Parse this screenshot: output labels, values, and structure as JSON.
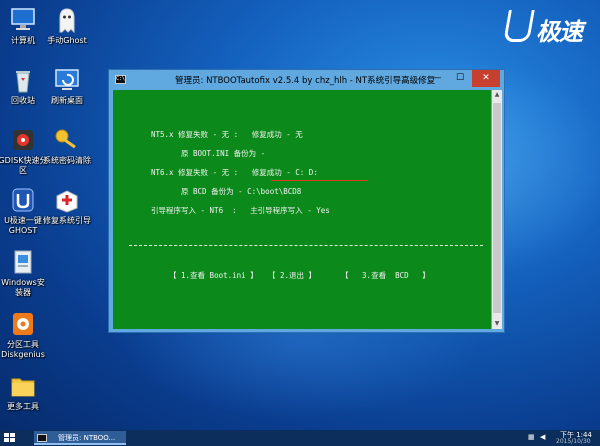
{
  "desktop_icons": [
    {
      "label": "计算机"
    },
    {
      "label": "手动Ghost"
    },
    {
      "label": "回收站"
    },
    {
      "label": "刷新桌面"
    },
    {
      "label": "GDISK快速分\n区"
    },
    {
      "label": "系统密码清除"
    },
    {
      "label": "U极速一键\nGHOST"
    },
    {
      "label": "修复系统引导"
    },
    {
      "label": "Windows安\n装器"
    },
    {
      "label": "分区工具\nDiskgenius"
    },
    {
      "label": "更多工具"
    }
  ],
  "logo": {
    "text": "极速"
  },
  "window": {
    "title": "管理员:  NTBOOTautofix v2.5.4 by chz_hlh - NT系统引导高级修复",
    "icon_text": "C:\\",
    "minimize": "—",
    "maximize": "☐",
    "close": "✕"
  },
  "console": {
    "lines": [
      "NT5.x 修复失败 - 无 :   修复成功 - 无",
      "原 BOOT.INI 备份为 -",
      "NT6.x 修复失败 - 无 :   修复成功 - C: D:",
      "原 BCD 备份为 - C:\\boot\\BCD8",
      "引导程序写入 - NT6  :   主引导程序写入 - Yes"
    ],
    "buttons": [
      "【 1.查看 Boot.ini 】",
      "【 2.退出 】",
      "【   3.查看  BCD   】"
    ]
  },
  "taskbar": {
    "task_label": "管理员:  NTBOO...",
    "time": "下午 1:44",
    "date": "2015/10/30"
  },
  "colors": {
    "console_bg": "#0b8a1b",
    "titlebar": "#5fa8e0",
    "close": "#c7402f",
    "underline": "#e23a1a"
  }
}
